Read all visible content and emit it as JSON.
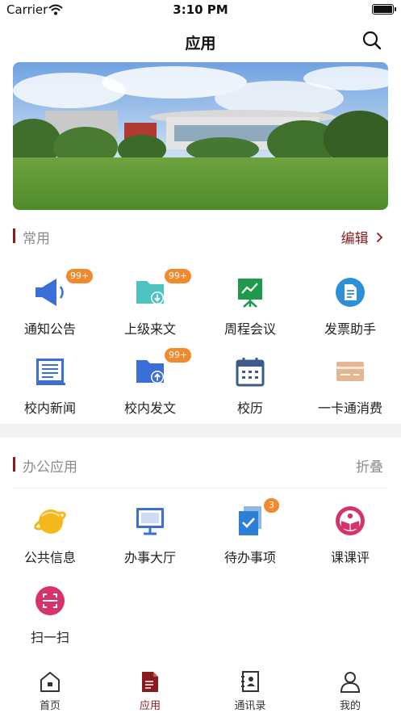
{
  "status_bar": {
    "carrier": "Carrier",
    "time": "3:10 PM"
  },
  "nav": {
    "title": "应用"
  },
  "common": {
    "title": "常用",
    "action": "编辑",
    "items": [
      {
        "label": "通知公告",
        "icon": "megaphone-icon",
        "badge": "99+"
      },
      {
        "label": "上级来文",
        "icon": "folder-download-icon",
        "badge": "99+"
      },
      {
        "label": "周程会议",
        "icon": "presentation-board-icon"
      },
      {
        "label": "发票助手",
        "icon": "invoice-icon"
      },
      {
        "label": "校内新闻",
        "icon": "newspaper-icon"
      },
      {
        "label": "校内发文",
        "icon": "folder-upload-icon",
        "badge": "99+"
      },
      {
        "label": "校历",
        "icon": "calendar-icon"
      },
      {
        "label": "一卡通消费",
        "icon": "card-icon"
      }
    ]
  },
  "office": {
    "title": "办公应用",
    "action": "折叠",
    "items": [
      {
        "label": "公共信息",
        "icon": "planet-icon"
      },
      {
        "label": "办事大厅",
        "icon": "monitor-icon"
      },
      {
        "label": "待办事项",
        "icon": "todo-clipboard-icon",
        "badge": "3"
      },
      {
        "label": "课课评",
        "icon": "book-review-icon"
      },
      {
        "label": "扫一扫",
        "icon": "scan-icon"
      }
    ]
  },
  "tabs": [
    {
      "label": "首页",
      "icon": "home-icon"
    },
    {
      "label": "应用",
      "icon": "app-document-icon",
      "active": true
    },
    {
      "label": "通讯录",
      "icon": "contacts-book-icon"
    },
    {
      "label": "我的",
      "icon": "person-icon"
    }
  ],
  "colors": {
    "accent": "#8b1a1f",
    "badge": "#f08a2c",
    "muted": "#8a8a8a",
    "blue": "#3b6fd8",
    "teal": "#4cc3bf",
    "green": "#1f9a4a",
    "orange_tan": "#e6b690",
    "pink": "#d6336c"
  }
}
